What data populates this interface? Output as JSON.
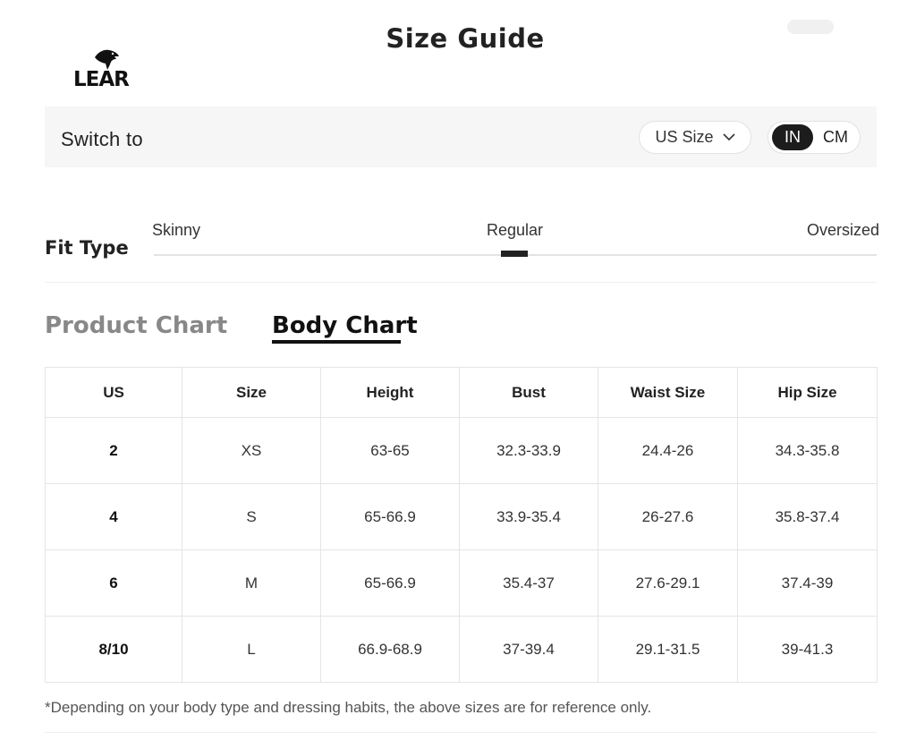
{
  "header": {
    "title": "Size Guide",
    "logo_text": "LEAR"
  },
  "switch_bar": {
    "label": "Switch to",
    "size_select": {
      "value": "US Size"
    },
    "unit_toggle": {
      "selected": "IN",
      "options": [
        "IN",
        "CM"
      ]
    }
  },
  "fit": {
    "label": "Fit Type",
    "options": [
      "Skinny",
      "Regular",
      "Oversized"
    ],
    "selected": "Regular"
  },
  "tabs": [
    {
      "label": "Product Chart",
      "active": false
    },
    {
      "label": "Body Chart",
      "active": true
    }
  ],
  "table": {
    "headers": [
      "US",
      "Size",
      "Height",
      "Bust",
      "Waist Size",
      "Hip Size"
    ],
    "rows": [
      [
        "2",
        "XS",
        "63-65",
        "32.3-33.9",
        "24.4-26",
        "34.3-35.8"
      ],
      [
        "4",
        "S",
        "65-66.9",
        "33.9-35.4",
        "26-27.6",
        "35.8-37.4"
      ],
      [
        "6",
        "M",
        "65-66.9",
        "35.4-37",
        "27.6-29.1",
        "37.4-39"
      ],
      [
        "8/10",
        "L",
        "66.9-68.9",
        "37-39.4",
        "29.1-31.5",
        "39-41.3"
      ]
    ]
  },
  "footnote": "*Depending on your body type and dressing habits, the above sizes are for reference only.",
  "colors": {
    "active_toggle": "#1c1c1c",
    "inactive_tab": "#888888",
    "bar_background": "#f6f6f6"
  }
}
